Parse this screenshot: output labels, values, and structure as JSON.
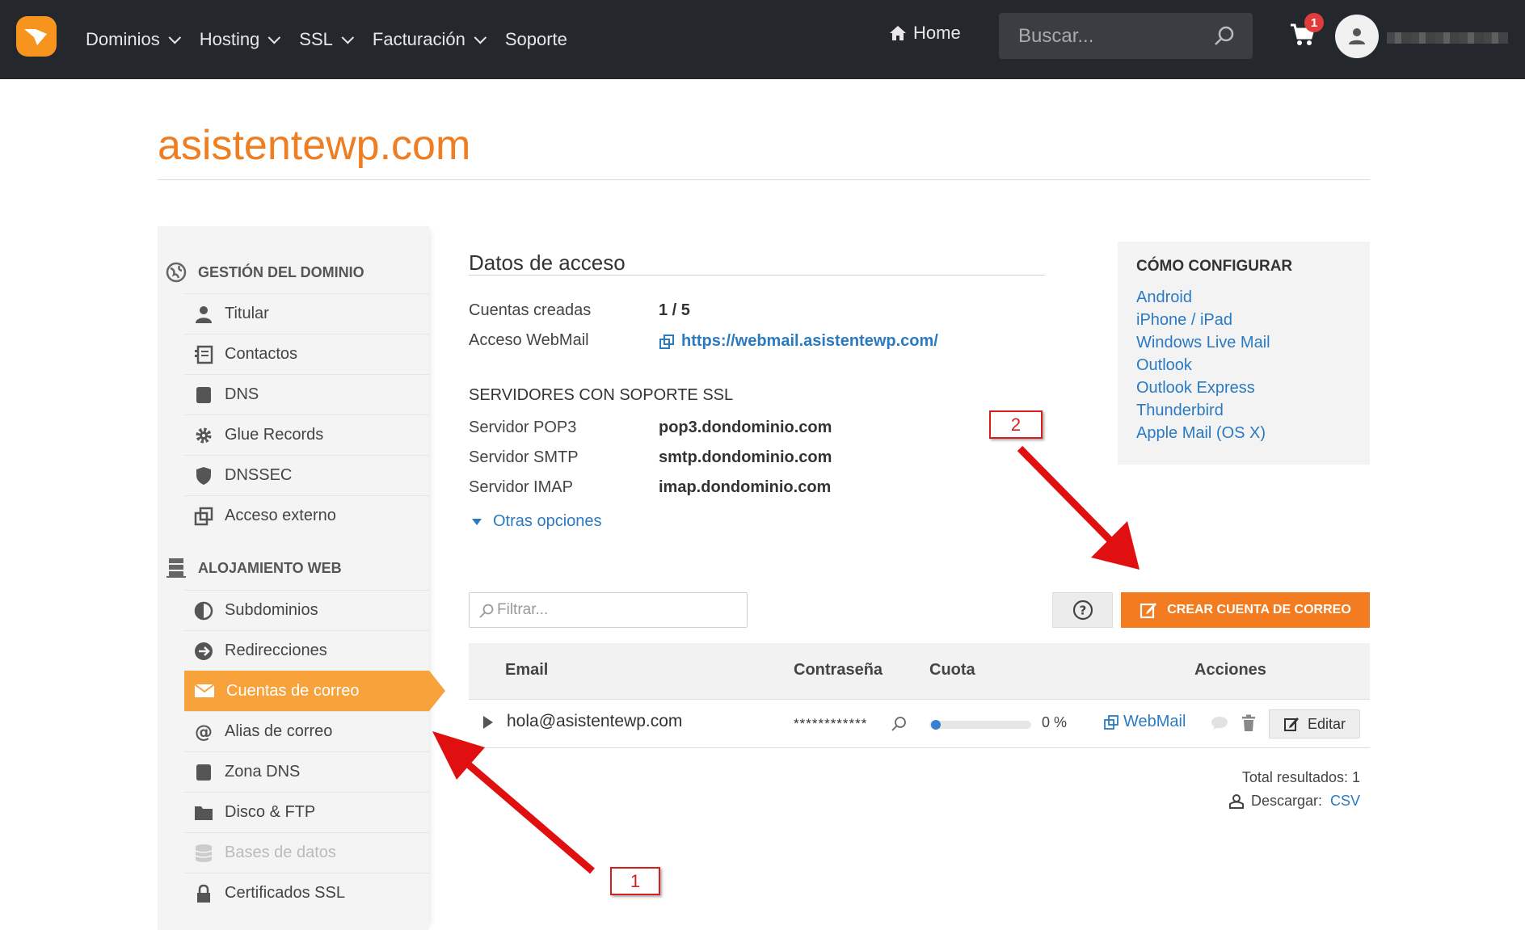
{
  "topbar": {
    "nav": [
      {
        "label": "Dominios",
        "has_dropdown": true
      },
      {
        "label": "Hosting",
        "has_dropdown": true
      },
      {
        "label": "SSL",
        "has_dropdown": true
      },
      {
        "label": "Facturación",
        "has_dropdown": true
      },
      {
        "label": "Soporte",
        "has_dropdown": false
      }
    ],
    "home_label": "Home",
    "search_placeholder": "Buscar...",
    "cart_count": "1",
    "colors": {
      "background": "#24272b",
      "accent": "#f7941d",
      "badge": "#e23b3b"
    }
  },
  "page": {
    "title": "asistentewp.com",
    "title_color": "#ef7d22"
  },
  "sidebar": {
    "sections": [
      {
        "header": "GESTIÓN DEL DOMINIO",
        "icon": "globe-icon",
        "items": [
          {
            "label": "Titular",
            "icon": "user-icon"
          },
          {
            "label": "Contactos",
            "icon": "contacts-icon"
          },
          {
            "label": "DNS",
            "icon": "dns-icon"
          },
          {
            "label": "Glue Records",
            "icon": "gear-icon"
          },
          {
            "label": "DNSSEC",
            "icon": "shield-icon"
          },
          {
            "label": "Acceso externo",
            "icon": "external-icon"
          }
        ]
      },
      {
        "header": "ALOJAMIENTO WEB",
        "icon": "server-icon",
        "items": [
          {
            "label": "Subdominios",
            "icon": "half-circle-icon"
          },
          {
            "label": "Redirecciones",
            "icon": "redirect-icon"
          },
          {
            "label": "Cuentas de correo",
            "icon": "envelope-icon",
            "active": true
          },
          {
            "label": "Alias de correo",
            "icon": "at-icon"
          },
          {
            "label": "Zona DNS",
            "icon": "dns-icon"
          },
          {
            "label": "Disco & FTP",
            "icon": "folder-icon"
          },
          {
            "label": "Bases de datos",
            "icon": "database-icon",
            "disabled": true
          },
          {
            "label": "Certificados SSL",
            "icon": "lock-icon"
          }
        ]
      }
    ]
  },
  "access": {
    "title": "Datos de acceso",
    "created_label": "Cuentas creadas",
    "created_value": "1 / 5",
    "webmail_label": "Acceso WebMail",
    "webmail_url": "https://webmail.asistentewp.com/",
    "servers_heading": "SERVIDORES CON SOPORTE SSL",
    "servers": [
      {
        "label": "Servidor POP3",
        "value": "pop3.dondominio.com"
      },
      {
        "label": "Servidor SMTP",
        "value": "smtp.dondominio.com"
      },
      {
        "label": "Servidor IMAP",
        "value": "imap.dondominio.com"
      }
    ],
    "more_options": "Otras opciones"
  },
  "config": {
    "title": "CÓMO CONFIGURAR",
    "links": [
      "Android",
      "iPhone / iPad",
      "Windows Live Mail",
      "Outlook",
      "Outlook Express",
      "Thunderbird",
      "Apple Mail (OS X)"
    ]
  },
  "toolbar": {
    "filter_placeholder": "Filtrar...",
    "create_label": "CREAR CUENTA DE CORREO",
    "create_color": "#f47c20"
  },
  "table": {
    "headers": {
      "email": "Email",
      "password": "Contraseña",
      "quota": "Cuota",
      "actions": "Acciones"
    },
    "rows": [
      {
        "email": "hola@asistentewp.com",
        "password": "************",
        "quota_fraction": 0,
        "quota_text": "0 %",
        "webmail": "WebMail",
        "edit": "Editar"
      }
    ]
  },
  "footer": {
    "total": "Total resultados: 1",
    "download_label": "Descargar:",
    "download_format": "CSV"
  },
  "annotations": {
    "label_1": "1",
    "label_2": "2",
    "color": "#d62020"
  }
}
